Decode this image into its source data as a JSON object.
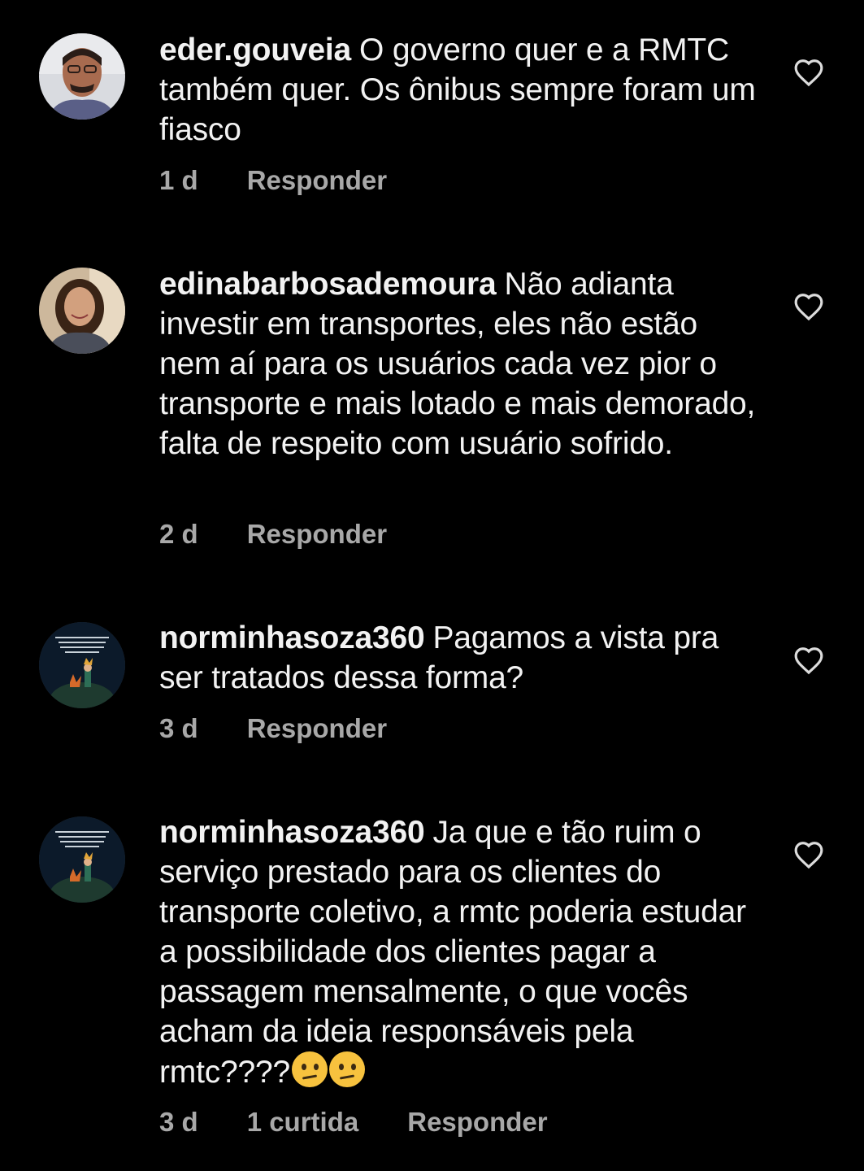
{
  "comments": [
    {
      "username": "eder.gouveia",
      "text": "O governo quer e a RMTC também quer. Os ônibus sempre foram um fiasco",
      "time": "1 d",
      "likes": "",
      "reply_label": "Responder",
      "avatar_icon": "man-photo-avatar"
    },
    {
      "username": "edinabarbosademoura",
      "text": "Não adianta investir em transportes, eles não estão nem aí para os usuários cada vez pior o transporte e mais lotado e mais demorado, falta de respeito com usuário sofrido.",
      "time": "2 d",
      "likes": "",
      "reply_label": "Responder",
      "avatar_icon": "woman-photo-avatar"
    },
    {
      "username": "norminhasoza360",
      "text": "Pagamos a vista pra ser tratados dessa forma?",
      "time": "3 d",
      "likes": "",
      "reply_label": "Responder",
      "avatar_icon": "little-prince-avatar"
    },
    {
      "username": "norminhasoza360",
      "text": "Ja que e tão ruim o serviço prestado para os clientes do transporte coletivo, a rmtc poderia estudar a possibilidade dos clientes pagar a passagem mensalmente, o que vocês acham da ideia responsáveis pela rmtc????",
      "time": "3 d",
      "likes": "1 curtida",
      "reply_label": "Responder",
      "avatar_icon": "little-prince-avatar",
      "emojis": [
        "raised-eyebrow-emoji",
        "raised-eyebrow-emoji"
      ]
    }
  ],
  "icons": {
    "like": "heart-outline-icon"
  },
  "colors": {
    "background": "#000000",
    "text": "#f2f2f2",
    "meta": "#a8a8a8"
  }
}
